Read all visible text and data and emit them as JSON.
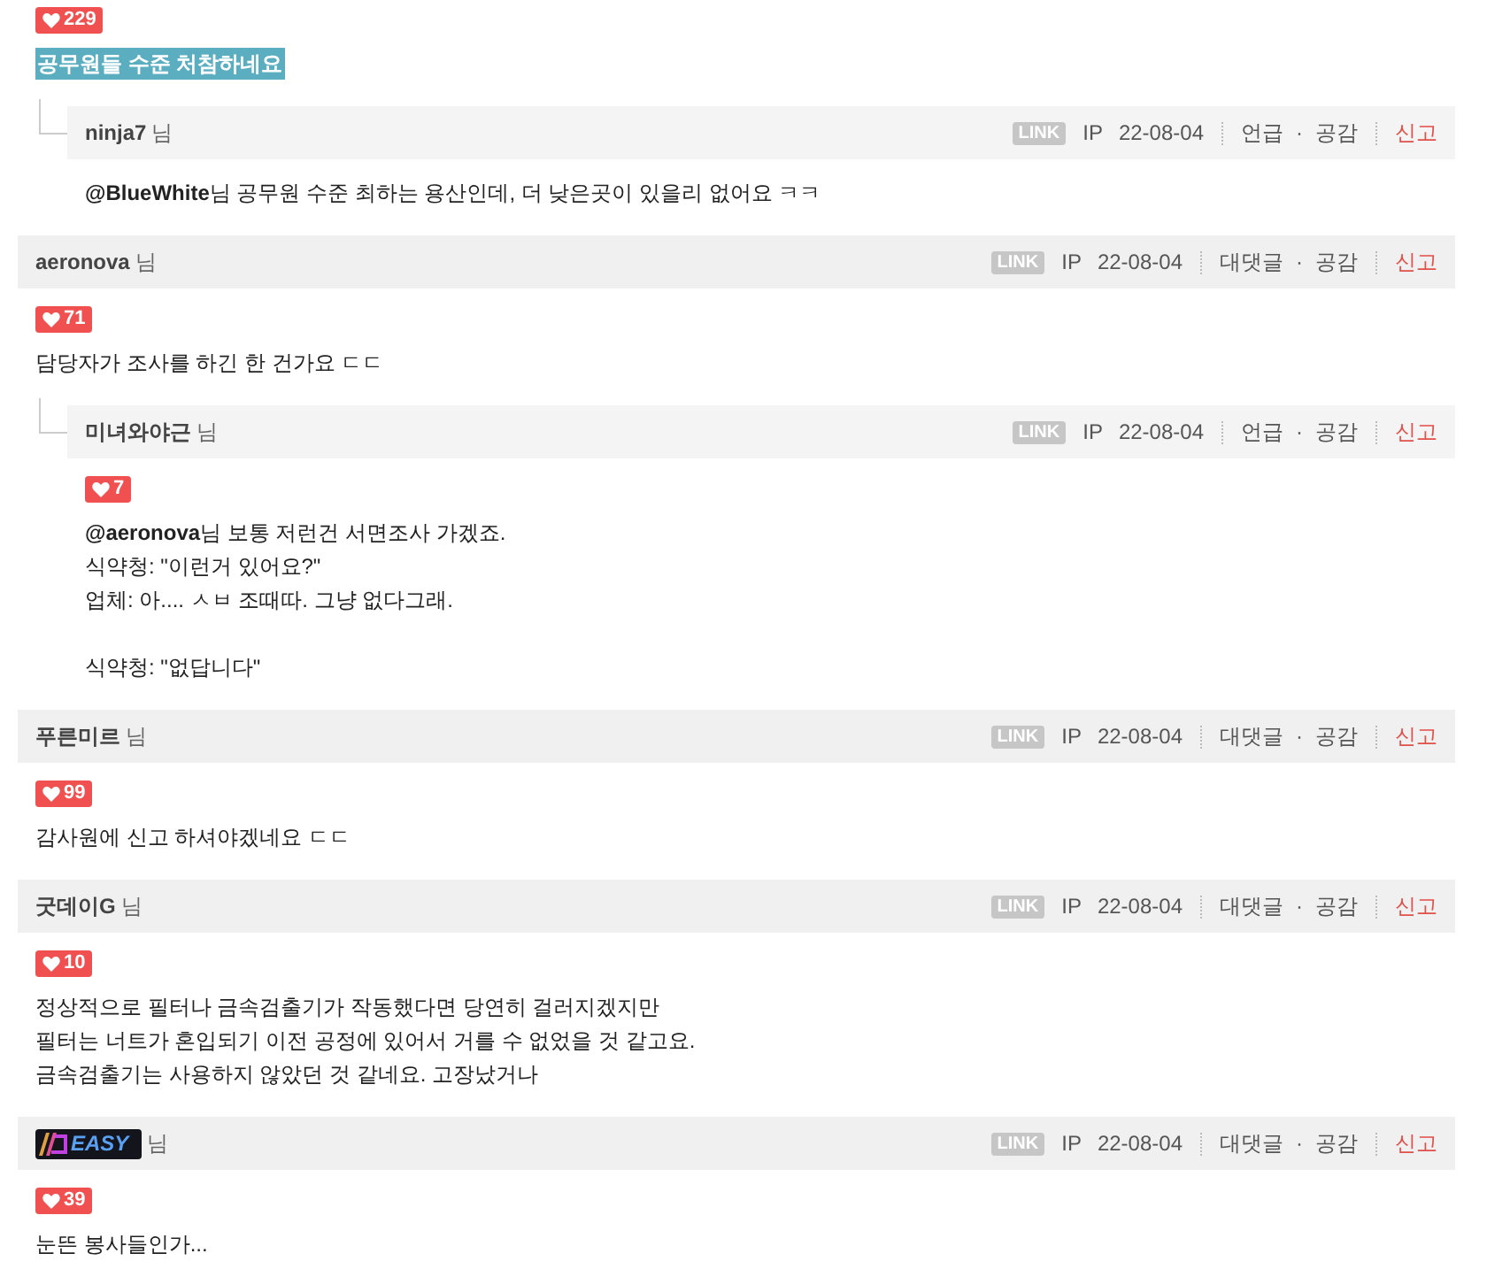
{
  "comments": [
    {
      "kind": "comment",
      "likes": "229",
      "highlighted": true,
      "body": [
        "공무원들 수준 처참하네요"
      ]
    },
    {
      "kind": "reply",
      "author": "ninja7",
      "honorific": "님",
      "link": "LINK",
      "ip": "IP",
      "date": "22-08-04",
      "action": "언급",
      "dot": "·",
      "empathy": "공감",
      "report": "신고",
      "body": [
        "**@BlueWhite**님 공무원 수준 최하는 용산인데, 더 낮은곳이 있을리 없어요 ㅋㅋ"
      ]
    },
    {
      "kind": "comment",
      "author": "aeronova",
      "honorific": "님",
      "link": "LINK",
      "ip": "IP",
      "date": "22-08-04",
      "action": "대댓글",
      "dot": "·",
      "empathy": "공감",
      "report": "신고",
      "likes": "71",
      "body": [
        "담당자가 조사를 하긴 한 건가요 ㄷㄷ"
      ]
    },
    {
      "kind": "reply",
      "author": "미녀와야근",
      "honorific": "님",
      "link": "LINK",
      "ip": "IP",
      "date": "22-08-04",
      "action": "언급",
      "dot": "·",
      "empathy": "공감",
      "report": "신고",
      "likes": "7",
      "body": [
        "**@aeronova**님 보통 저런건 서면조사 가겠죠.\n식약청: \"이런거 있어요?\"\n업체: 아.... ㅅㅂ 조때따. 그냥 없다그래.",
        "식약청: \"없답니다\""
      ]
    },
    {
      "kind": "comment",
      "author": "푸른미르",
      "honorific": "님",
      "link": "LINK",
      "ip": "IP",
      "date": "22-08-04",
      "action": "대댓글",
      "dot": "·",
      "empathy": "공감",
      "report": "신고",
      "likes": "99",
      "body": [
        "감사원에 신고 하셔야겠네요 ㄷㄷ"
      ]
    },
    {
      "kind": "comment",
      "author": "굿데이G",
      "honorific": "님",
      "link": "LINK",
      "ip": "IP",
      "date": "22-08-04",
      "action": "대댓글",
      "dot": "·",
      "empathy": "공감",
      "report": "신고",
      "likes": "10",
      "body": [
        "정상적으로 필터나 금속검출기가 작동했다면 당연히 걸러지겠지만\n필터는 너트가 혼입되기 이전 공정에 있어서 거를 수 없었을 것 같고요.\n금속검출기는 사용하지 않았던 것 같네요. 고장났거나"
      ]
    },
    {
      "kind": "comment",
      "author_badge": "EASY",
      "honorific": "님",
      "link": "LINK",
      "ip": "IP",
      "date": "22-08-04",
      "action": "대댓글",
      "dot": "·",
      "empathy": "공감",
      "report": "신고",
      "likes": "39",
      "body": [
        "눈뜬 봉사들인가..."
      ]
    }
  ]
}
